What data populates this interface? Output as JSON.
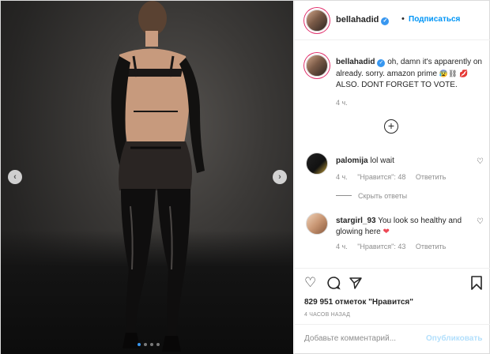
{
  "header": {
    "username": "bellahadid",
    "separator": "•",
    "follow_label": "Подписаться"
  },
  "caption": {
    "username": "bellahadid",
    "text": "oh, damn it's apparently on already. sorry. amazon prime",
    "text2": "ALSO. DONT FORGET TO VOTE.",
    "time": "4 ч."
  },
  "comments": [
    {
      "username": "palomija",
      "text": "lol wait",
      "time": "4 ч.",
      "likes": "\"Нравится\": 48",
      "reply_label": "Ответить"
    },
    {
      "username": "stargirl_93",
      "text": "You look so healthy and glowing here",
      "time": "4 ч.",
      "likes": "\"Нравится\": 43",
      "reply_label": "Ответить"
    }
  ],
  "replies": {
    "label": "Скрыть ответы"
  },
  "actions": {
    "likes_count": "829 951 отметок \"Нравится\"",
    "posted_time": "4 ЧАСОВ НАЗАД"
  },
  "add_comment": {
    "placeholder": "Добавьте комментарий...",
    "publish_label": "Опубликовать"
  },
  "icons": {
    "left_arrow": "chevron-left-icon",
    "right_arrow": "chevron-right-icon",
    "load_more": "plus-circle-icon",
    "like": "heart-icon",
    "comment": "comment-icon",
    "share": "share-icon",
    "save": "bookmark-icon"
  },
  "carousel": {
    "count": 4,
    "active": 0
  },
  "colors": {
    "accent": "#0095f6",
    "verified": "#3897f0",
    "publish_disabled": "#b2dffc",
    "muted": "#8e8e8e"
  }
}
